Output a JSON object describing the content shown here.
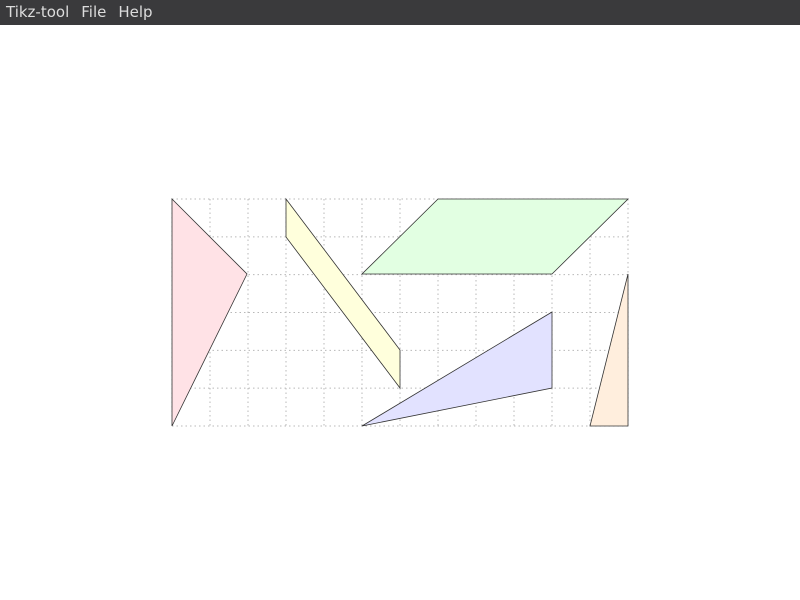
{
  "menubar": {
    "app_name": "Tikz-tool",
    "items": [
      "File",
      "Help"
    ]
  },
  "colors": {
    "menubar_bg": "#3a3a3c",
    "menubar_text": "#dcdcdc",
    "grid": "#b8b8b8",
    "stroke": "#333333"
  },
  "shapes": [
    {
      "name": "pink-triangle",
      "fill": "#ffe2e6"
    },
    {
      "name": "yellow-parallelogram",
      "fill": "#ffffdc"
    },
    {
      "name": "green-parallelogram",
      "fill": "#e2ffe2"
    },
    {
      "name": "blue-triangle",
      "fill": "#e2e2ff"
    },
    {
      "name": "orange-triangle",
      "fill": "#ffeedd"
    }
  ]
}
